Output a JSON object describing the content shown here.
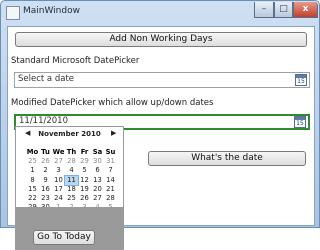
{
  "window": {
    "title": "MainWindow"
  },
  "title_buttons": {
    "minimize": "–",
    "maximize": "□",
    "close": "x"
  },
  "main": {
    "add_button": "Add Non Working Days",
    "standard_label": "Standard Microsoft DatePicker",
    "standard_placeholder": "Select a date",
    "modified_label": "Modified DatePicker which allow up/down dates",
    "modified_value": "11/11/2010",
    "whats_date_button": "What's the date",
    "calendar_icon_day": "15"
  },
  "calendar": {
    "month": "November 2010",
    "prev": "◀",
    "next": "▶",
    "weekdays": [
      "Mo",
      "Tu",
      "We",
      "Th",
      "Fr",
      "Sa",
      "Su"
    ],
    "weeks": [
      [
        "25",
        "26",
        "27",
        "28",
        "29",
        "30",
        "31"
      ],
      [
        "1",
        "2",
        "3",
        "4",
        "5",
        "6",
        "7"
      ],
      [
        "8",
        "9",
        "10",
        "11",
        "12",
        "13",
        "14"
      ],
      [
        "15",
        "16",
        "17",
        "18",
        "19",
        "20",
        "21"
      ],
      [
        "22",
        "23",
        "24",
        "25",
        "26",
        "27",
        "28"
      ],
      [
        "29",
        "30",
        "1",
        "2",
        "3",
        "4",
        "5"
      ]
    ],
    "selected": "11",
    "go_today": "Go To Today"
  }
}
